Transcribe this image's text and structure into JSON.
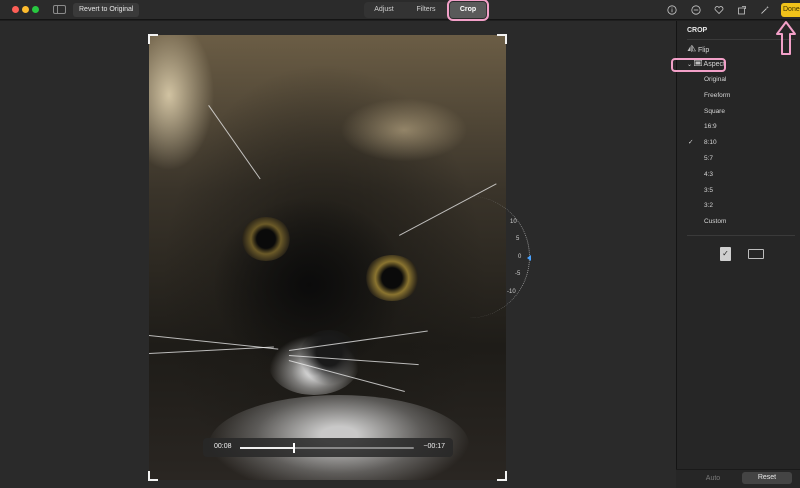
{
  "toolbar": {
    "revert_label": "Revert to Original",
    "tabs": [
      {
        "label": "Adjust"
      },
      {
        "label": "Filters"
      },
      {
        "label": "Crop",
        "selected": true
      }
    ],
    "icons": [
      "info-icon",
      "minus-circle-icon",
      "heart-icon",
      "rotate-icon",
      "magic-wand-icon"
    ],
    "done_label": "Done"
  },
  "canvas": {
    "scrubber": {
      "current_time": "00:08",
      "remaining_time": "−00:17",
      "progress": 0.31
    },
    "straighten_dial": {
      "ticks": [
        "10",
        "5",
        "0",
        "-5",
        "-10"
      ],
      "value": 0
    }
  },
  "sidebar": {
    "title": "CROP",
    "flip_label": "Flip",
    "aspect_label": "Aspect",
    "aspect_options": [
      "Original",
      "Freeform",
      "Square",
      "16:9",
      "8:10",
      "5:7",
      "4:3",
      "3:5",
      "3:2",
      "Custom"
    ],
    "selected_option": "8:10",
    "checkmark": "✓",
    "orientation_selected": "portrait",
    "auto_label": "Auto",
    "reset_label": "Reset"
  },
  "colors": {
    "accent_done": "#f0c21a",
    "highlight_pink": "#f2a0c8",
    "dial_marker": "#4aa3ff"
  }
}
